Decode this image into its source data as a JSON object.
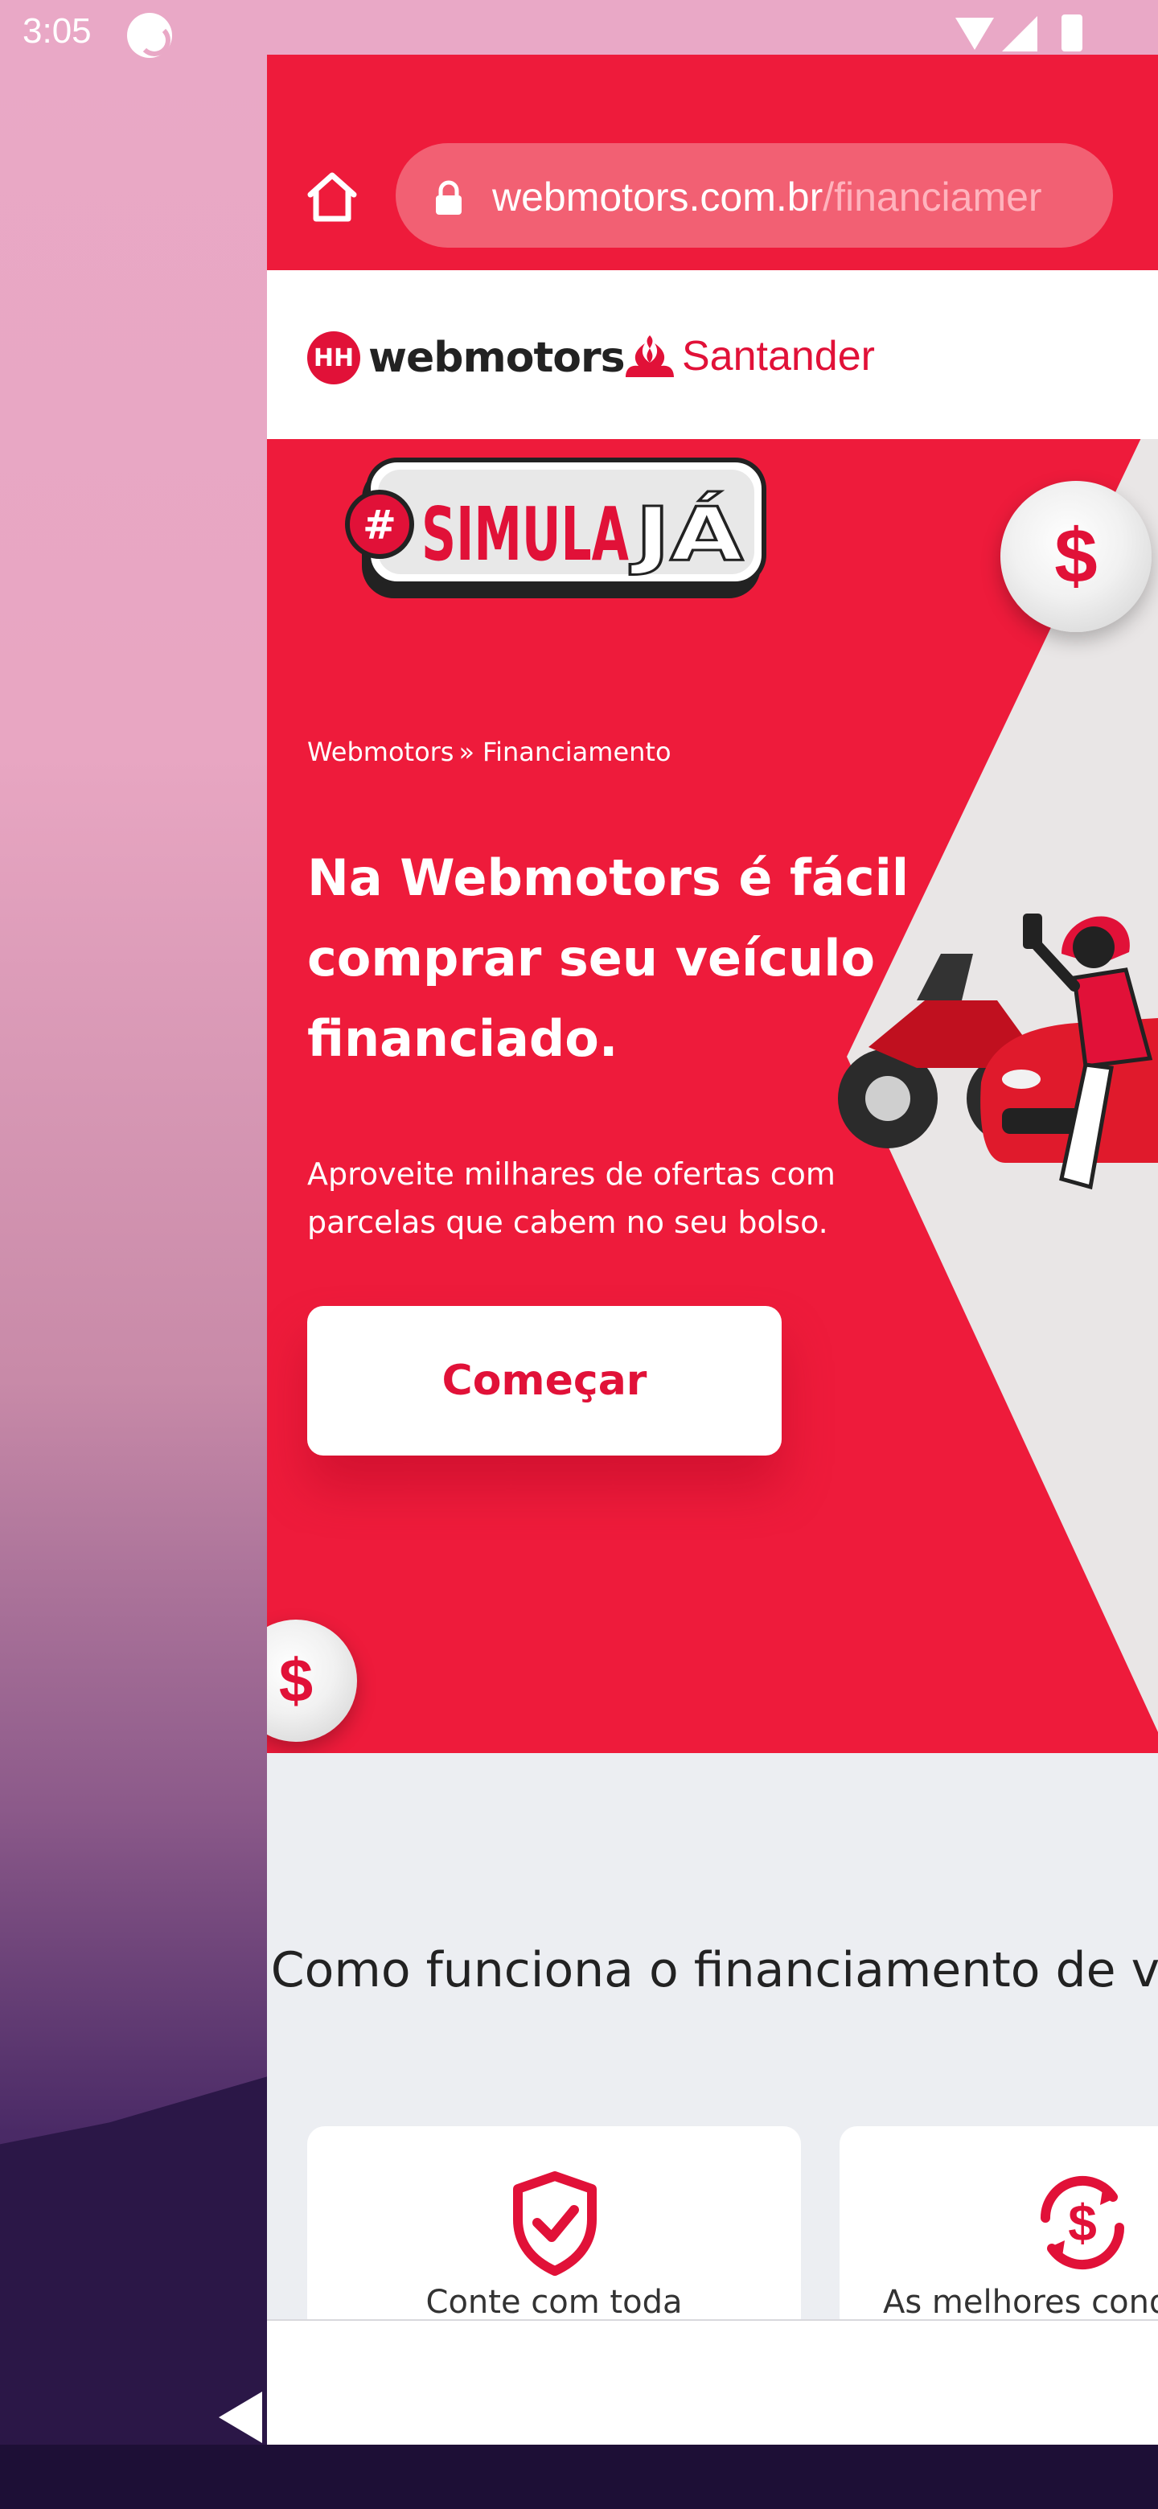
{
  "status_bar": {
    "time": "3:05"
  },
  "browser": {
    "url_domain": "webmotors.com.br",
    "url_path": "/financiamer"
  },
  "brand": {
    "webmotors_mark": "HH",
    "webmotors": "webmotors",
    "santander": "Santander"
  },
  "hero": {
    "badge_hash": "#",
    "badge_text": "SIMULA",
    "badge_text_accent": "JÁ",
    "coin_symbol": "$",
    "breadcrumb": [
      {
        "label": "Webmotors",
        "sep": "»"
      },
      {
        "label": "Financiamento"
      }
    ],
    "headline": "Na Webmotors é fácil comprar seu veículo financiado.",
    "subline": "Aproveite milhares de ofertas com parcelas que cabem no seu bolso.",
    "cta_label": "Começar"
  },
  "how_it_works": {
    "title": "Como funciona o financiamento de veículos?",
    "cards": [
      {
        "text": "Conte com toda",
        "icon": "shield-check-icon"
      },
      {
        "text": "As melhores condi",
        "icon": "dollar-refresh-icon"
      }
    ]
  },
  "colors": {
    "brand_red": "#ee1b3b",
    "logo_red": "#e11138",
    "section_bg": "#eceef2"
  }
}
